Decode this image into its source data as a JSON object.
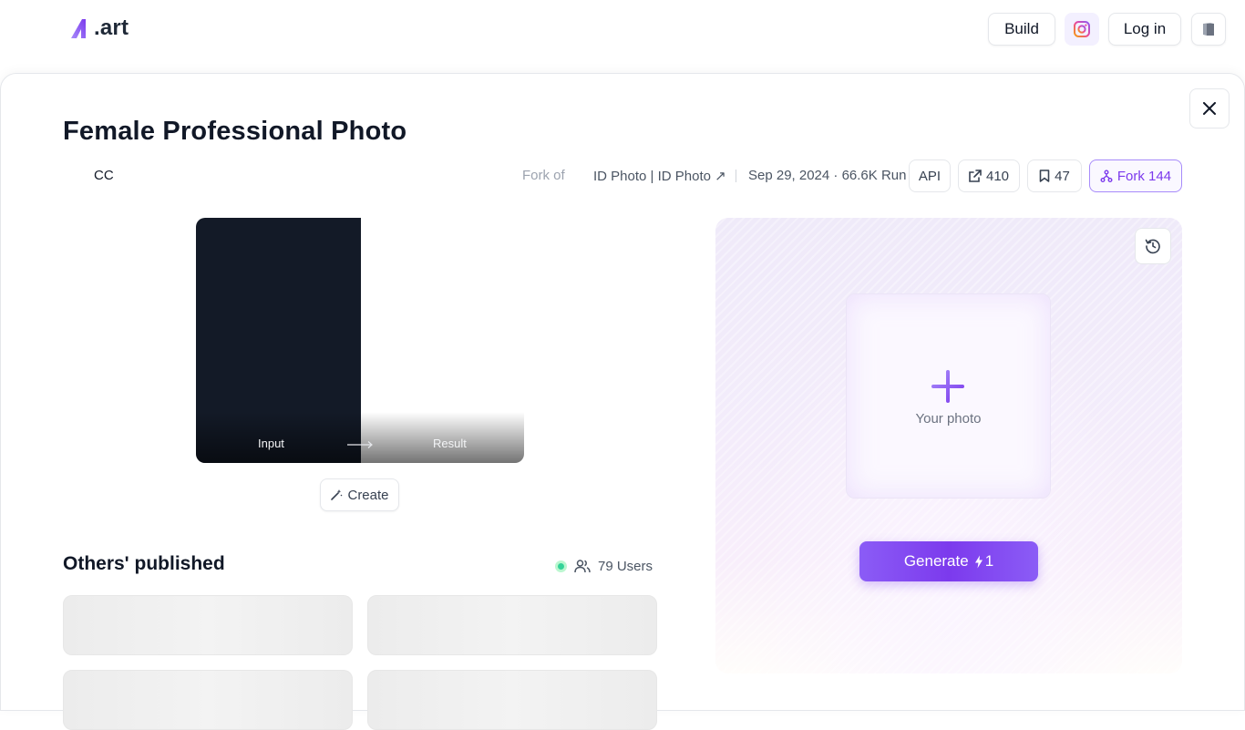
{
  "header": {
    "logo_text": ".art",
    "build_label": "Build",
    "login_label": "Log in"
  },
  "model": {
    "title": "Female Professional Photo",
    "author": "CC",
    "fork_of_label": "Fork of",
    "fork_source": "ID Photo | ID Photo ↗",
    "date_runs": "Sep 29, 2024 · 66.6K Run",
    "api_label": "API",
    "share_count": "410",
    "save_count": "47",
    "fork_label": "Fork 144"
  },
  "preview": {
    "input_label": "Input",
    "result_label": "Result",
    "create_label": "Create"
  },
  "published": {
    "title": "Others' published",
    "users": "79 Users"
  },
  "generator": {
    "photo_label": "Your photo",
    "generate_label": "Generate",
    "cost": "1"
  },
  "colors": {
    "accent": "#7c3aed",
    "online": "#34d399"
  }
}
